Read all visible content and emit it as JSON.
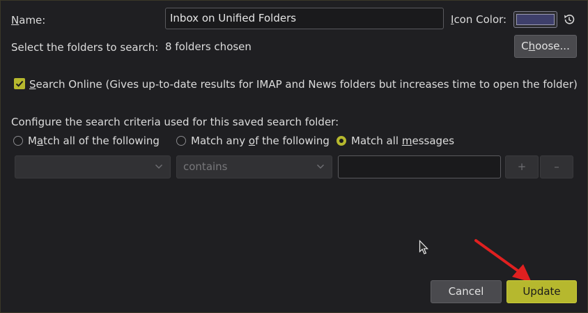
{
  "form": {
    "name_label_prefix": "N",
    "name_label_underline": "a",
    "name_label_suffix": "me:",
    "name_value": "Inbox on Unified Folders",
    "icon_color_label_prefix": "",
    "icon_color_label_underline": "I",
    "icon_color_label_suffix": "con Color:",
    "icon_color_value": "#3e3f6b",
    "folders_label": "Select the folders to search:",
    "folders_value": "8 folders chosen",
    "choose_prefix": "C",
    "choose_underline": "h",
    "choose_suffix": "oose...",
    "search_online_underline": "S",
    "search_online_suffix": "earch Online (Gives up-to-date results for IMAP and News folders but increases time to open the folder)",
    "search_online_checked": true
  },
  "criteria": {
    "heading": "Configure the search criteria used for this saved search folder:",
    "options": [
      {
        "prefix": "M",
        "underline": "a",
        "suffix": "tch all of the following",
        "selected": false
      },
      {
        "prefix": "Match any ",
        "underline": "o",
        "suffix": "f the following",
        "selected": false
      },
      {
        "prefix": "Match all ",
        "underline": "m",
        "suffix": "essages",
        "selected": true
      }
    ],
    "rule": {
      "field_value": "",
      "operator_value": "contains",
      "text_value": "",
      "add_label": "+",
      "remove_label": "–"
    }
  },
  "footer": {
    "cancel_label": "Cancel",
    "update_label": "Update"
  },
  "colors": {
    "accent": "#b6b82e",
    "annotation": "#e02020"
  }
}
